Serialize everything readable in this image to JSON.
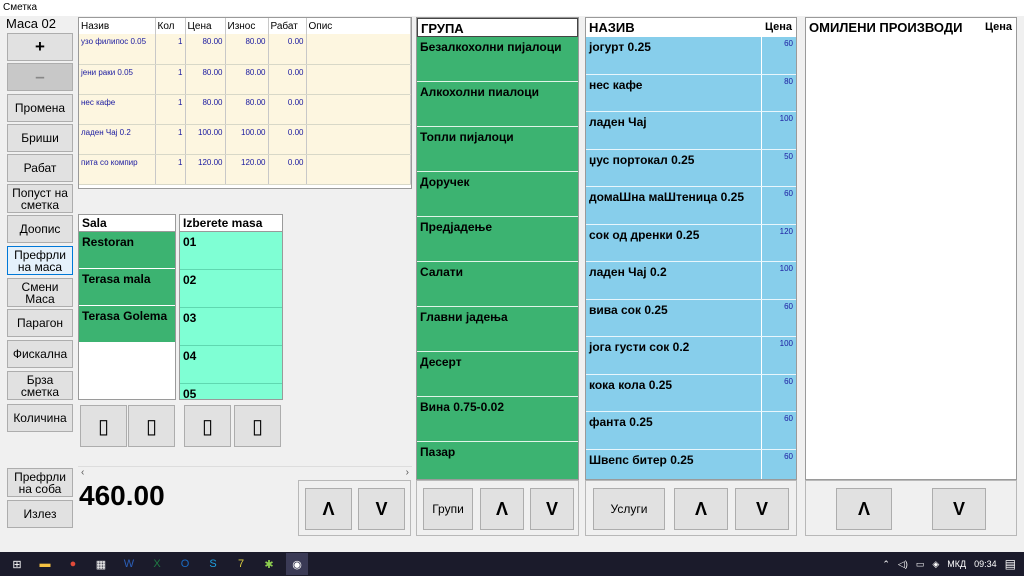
{
  "window": {
    "title": "Сметка"
  },
  "table_label": "Маса 02",
  "left_buttons": [
    {
      "label": "+",
      "name": "plus-button"
    },
    {
      "label": "–",
      "name": "minus-button"
    },
    {
      "label": "Промена",
      "name": "change-button"
    },
    {
      "label": "Бриши",
      "name": "delete-button"
    },
    {
      "label": "Рабат",
      "name": "discount-button"
    },
    {
      "label": "Попуст на\nсметка",
      "name": "bill-discount-button"
    },
    {
      "label": "Доопис",
      "name": "note-button"
    },
    {
      "label": "Префрли\nна маса",
      "name": "transfer-table-button"
    },
    {
      "label": "Смени\nМаса",
      "name": "change-table-button"
    },
    {
      "label": "Парагон",
      "name": "receipt-button"
    },
    {
      "label": "Фискална",
      "name": "fiscal-button"
    },
    {
      "label": "Брза\nсметка",
      "name": "quick-bill-button"
    },
    {
      "label": "Количина",
      "name": "quantity-button"
    },
    {
      "label": "Префрли\nна соба",
      "name": "transfer-room-button"
    },
    {
      "label": "Излез",
      "name": "exit-button"
    }
  ],
  "order_grid": {
    "columns": [
      "Назив",
      "Кол",
      "Цена",
      "Износ",
      "Рабат",
      "Опис"
    ],
    "rows": [
      [
        "узо филипос 0.05",
        "1",
        "80.00",
        "80.00",
        "0.00",
        ""
      ],
      [
        "јени раки 0.05",
        "1",
        "80.00",
        "80.00",
        "0.00",
        ""
      ],
      [
        "нес кафе",
        "1",
        "80.00",
        "80.00",
        "0.00",
        ""
      ],
      [
        "ладен Чај 0.2",
        "1",
        "100.00",
        "100.00",
        "0.00",
        ""
      ],
      [
        "пита со компир",
        "1",
        "120.00",
        "120.00",
        "0.00",
        ""
      ]
    ]
  },
  "sala": {
    "header": "Sala",
    "items": [
      "Restoran",
      "Terasa mala",
      "Terasa Golema"
    ]
  },
  "masa": {
    "header": "Izberete masa",
    "items": [
      "01",
      "02",
      "03",
      "04",
      "05"
    ]
  },
  "total": "460.00",
  "groups": {
    "header": "ГРУПА",
    "items": [
      "Безалкохолни пијалоци",
      "Алкохолни пиалоци",
      "Топли пијалоци",
      "Доручек",
      "Предјадење",
      "Салати",
      "Главни јадења",
      "Десерт",
      "Вина 0.75-0.02",
      "Пазар"
    ],
    "bottom_button": "Групи"
  },
  "products": {
    "header_name": "НАЗИВ",
    "header_price": "Цена",
    "items": [
      {
        "name": "јогурт 0.25",
        "price": "60"
      },
      {
        "name": "нес кафе",
        "price": "80"
      },
      {
        "name": "ладен Чај",
        "price": "100"
      },
      {
        "name": "џус портокал  0.25",
        "price": "50"
      },
      {
        "name": "домаШна маШтеница 0.25",
        "price": "60"
      },
      {
        "name": "сок од дренки 0.25",
        "price": "120"
      },
      {
        "name": "ладен Чај 0.2",
        "price": "100"
      },
      {
        "name": "вива сок 0.25",
        "price": "60"
      },
      {
        "name": "јога густи сок 0.2",
        "price": "100"
      },
      {
        "name": "кока кола 0.25",
        "price": "60"
      },
      {
        "name": "фанта 0.25",
        "price": "60"
      },
      {
        "name": "Швепс битер 0.25",
        "price": "60"
      }
    ],
    "bottom_button": "Услуги"
  },
  "favorites": {
    "header_name": "ОМИЛЕНИ ПРОИЗВОДИ",
    "header_price": "Цена"
  },
  "nav": {
    "up": "Λ",
    "down": "V"
  },
  "taskbar": {
    "tray_lang": "МКД",
    "tray_time": "09:34"
  }
}
